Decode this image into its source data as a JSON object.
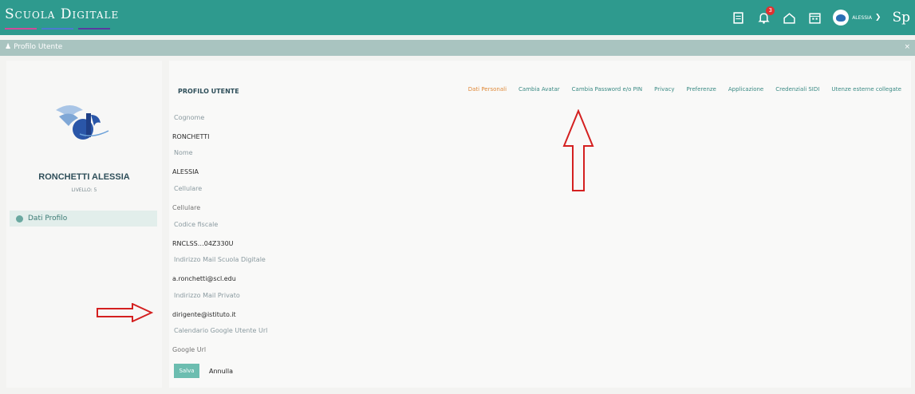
{
  "app": {
    "brand": "Scuola Digitale",
    "sp_text": "Sp"
  },
  "header": {
    "icons": [
      "document-icon",
      "bell-icon",
      "home-icon",
      "calendar-icon"
    ],
    "notification_count": "3",
    "user_label": "ALESSIA"
  },
  "subheader": {
    "title": "Profilo Utente",
    "close": "×"
  },
  "sidebar": {
    "user_name": "RONCHETTI ALESSIA",
    "level": "LIVELLO: 5",
    "items": [
      {
        "label": "Dati Profilo"
      }
    ]
  },
  "main": {
    "section_title": "PROFILO UTENTE",
    "tabs": [
      {
        "label": "Dati Personali",
        "active": true
      },
      {
        "label": "Cambia Avatar"
      },
      {
        "label": "Cambia Password e/o PIN"
      },
      {
        "label": "Privacy"
      },
      {
        "label": "Preferenze"
      },
      {
        "label": "Applicazione"
      },
      {
        "label": "Credenziali SIDI"
      },
      {
        "label": "Utenze esterne collegate"
      }
    ],
    "fields": [
      {
        "label": "Cognome",
        "value": "RONCHETTI",
        "placeholder": ""
      },
      {
        "label": "Nome",
        "value": "ALESSIA",
        "placeholder": ""
      },
      {
        "label": "Cellulare",
        "value": "",
        "placeholder": "Cellulare"
      },
      {
        "label": "Codice fiscale",
        "value": "RNCLSS…04Z330U",
        "placeholder": ""
      },
      {
        "label": "Indirizzo Mail Scuola Digitale",
        "value": "a.ronchetti@scl.edu",
        "placeholder": ""
      },
      {
        "label": "Indirizzo Mail Privato",
        "value": "dirigente@istituto.it",
        "placeholder": ""
      },
      {
        "label": "Calendario Google Utente Url",
        "value": "",
        "placeholder": "Google Url"
      }
    ],
    "save_label": "Salva",
    "cancel_label": "Annulla"
  },
  "colors": {
    "topbar": "#2e9a8e",
    "active_tab": "#e08a3a",
    "annotation_arrow": "#d42020"
  }
}
